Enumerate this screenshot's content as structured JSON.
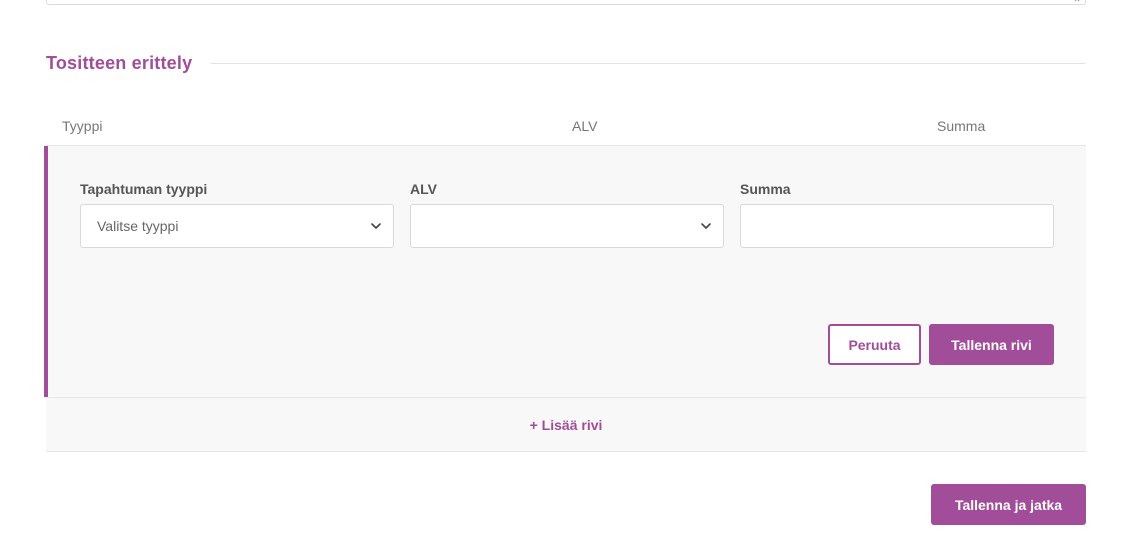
{
  "section": {
    "title": "Tositteen erittely"
  },
  "table_header": {
    "type": "Tyyppi",
    "alv": "ALV",
    "sum": "Summa"
  },
  "edit_row": {
    "type_field": {
      "label": "Tapahtuman tyyppi",
      "value": "Valitse tyyppi"
    },
    "alv_field": {
      "label": "ALV",
      "value": ""
    },
    "sum_field": {
      "label": "Summa",
      "value": ""
    },
    "cancel_label": "Peruuta",
    "save_row_label": "Tallenna rivi"
  },
  "add_row_label": "+ Lisää rivi",
  "save_continue_label": "Tallenna ja jatka",
  "colors": {
    "accent": "#a24d9a",
    "row_background": "#f8f8f8"
  },
  "icons": {
    "select_chevron": "chevron-down-icon",
    "resize": "resize-grip-icon"
  }
}
